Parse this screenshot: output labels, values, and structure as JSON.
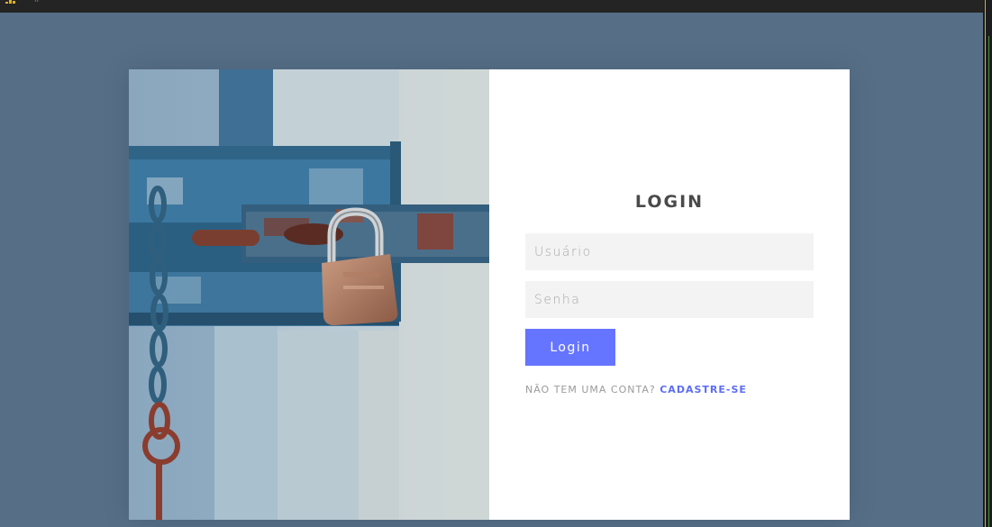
{
  "login": {
    "title": "LOGIN",
    "username_placeholder": "Usuário",
    "password_placeholder": "Senha",
    "submit_label": "Login",
    "signup_prompt": "NÃO TEM UMA CONTA?",
    "signup_link": "CADASTRE-SE"
  },
  "colors": {
    "background": "#566f87",
    "button": "#6675ff",
    "link": "#5c6df5",
    "input_background": "#f3f3f3"
  },
  "icons": [
    "padlock-door-photo"
  ]
}
